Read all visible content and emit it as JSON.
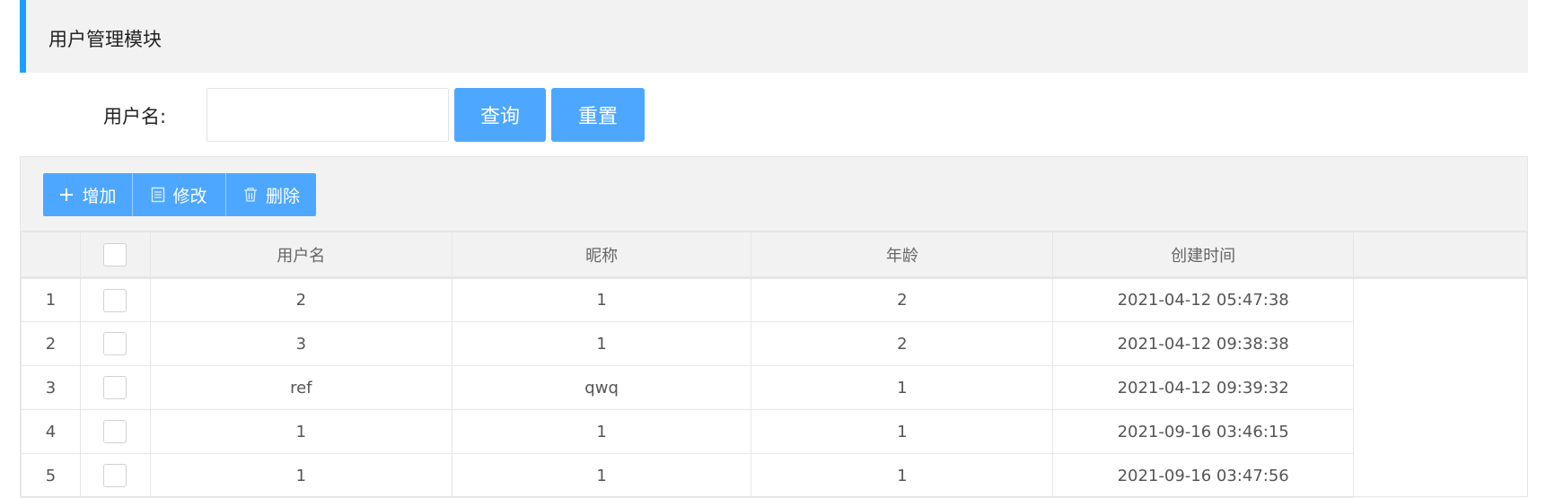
{
  "header": {
    "title": "用户管理模块"
  },
  "search": {
    "label": "用户名:",
    "value": "",
    "placeholder": ""
  },
  "buttons": {
    "query": "查询",
    "reset": "重置"
  },
  "toolbar": {
    "add": "增加",
    "edit": "修改",
    "delete": "删除"
  },
  "table": {
    "columns": [
      "用户名",
      "昵称",
      "年龄",
      "创建时间"
    ],
    "rows": [
      {
        "index": "1",
        "username": "2",
        "nickname": "1",
        "age": "2",
        "created": "2021-04-12 05:47:38"
      },
      {
        "index": "2",
        "username": "3",
        "nickname": "1",
        "age": "2",
        "created": "2021-04-12 09:38:38"
      },
      {
        "index": "3",
        "username": "ref",
        "nickname": "qwq",
        "age": "1",
        "created": "2021-04-12 09:39:32"
      },
      {
        "index": "4",
        "username": "1",
        "nickname": "1",
        "age": "1",
        "created": "2021-09-16 03:46:15"
      },
      {
        "index": "5",
        "username": "1",
        "nickname": "1",
        "age": "1",
        "created": "2021-09-16 03:47:56"
      }
    ]
  },
  "colors": {
    "accent": "#4ea7ff",
    "header_bar": "#1e9fff",
    "panel_bg": "#f2f2f2"
  }
}
